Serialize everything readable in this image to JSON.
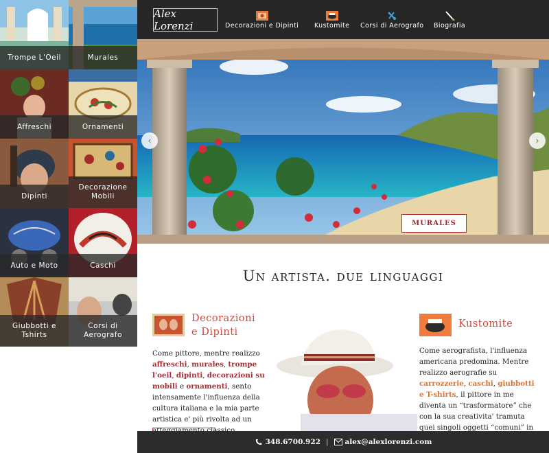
{
  "sidebar": {
    "tiles": [
      {
        "label": "Trompe L'Oeil"
      },
      {
        "label": "Murales"
      },
      {
        "label": "Affreschi"
      },
      {
        "label": "Ornamenti"
      },
      {
        "label": "Dipinti"
      },
      {
        "label": "Decorazione Mobili"
      },
      {
        "label": "Auto e Moto"
      },
      {
        "label": "Caschi"
      },
      {
        "label": "Giubbotti e Tshirts"
      },
      {
        "label": "Corsi di Aerografo"
      }
    ]
  },
  "nav": {
    "logo": "Alex Lorenzi",
    "items": [
      {
        "label": "Decorazioni e Dipinti",
        "icon": "painting-icon"
      },
      {
        "label": "Kustomite",
        "icon": "kustom-icon"
      },
      {
        "label": "Corsi di Aerografo",
        "icon": "airbrush-icon"
      },
      {
        "label": "Biografia",
        "icon": "brush-icon"
      }
    ]
  },
  "hero": {
    "button_label": "MURALES",
    "prev_arrow": "‹",
    "next_arrow": "›"
  },
  "main": {
    "section_title": "Un artista. due linguaggi",
    "left": {
      "title_line1": "Decorazioni",
      "title_line2": "e Dipinti",
      "t1": "Come pittore, mentre realizzo ",
      "l1": "affreschi",
      "t2": ", ",
      "l2": "murales",
      "t3": ", ",
      "l3": "trompe l'oeil",
      "t4": ", ",
      "l4": "dipinti",
      "t5": ", ",
      "l5": "decorazioni su mobili",
      "t6": " e ",
      "l6": "ornamenti",
      "t7": ", sento intensamente l'influenza della cultura italiana e la mia parte artistica e' più rivolta ad un atteggiamento classico."
    },
    "right": {
      "title": "Kustomite",
      "t1": "Come aerografista, l'influenza americana predomina. Mentre realizzo aerografie su ",
      "l1": "carrozzerie",
      "t2": ", ",
      "l2": "caschi",
      "t3": ", ",
      "l3": "giubbotti e T-shirts",
      "t4": ", il pittore in me diventa un “trasformatore” che con la sua creativita' tramuta quei singoli oggetti “comuni” in oggetti “originali ed unici: in una sola"
    }
  },
  "footer": {
    "phone": "348.6700.922",
    "separator": "|",
    "email": "alex@alexlorenzi.com"
  },
  "colors": {
    "nav_bg": "#262626",
    "accent_red": "#d0483b",
    "link_red": "#b02a2f",
    "link_orange": "#e0702c",
    "footer_bg": "#2c2c2c"
  }
}
